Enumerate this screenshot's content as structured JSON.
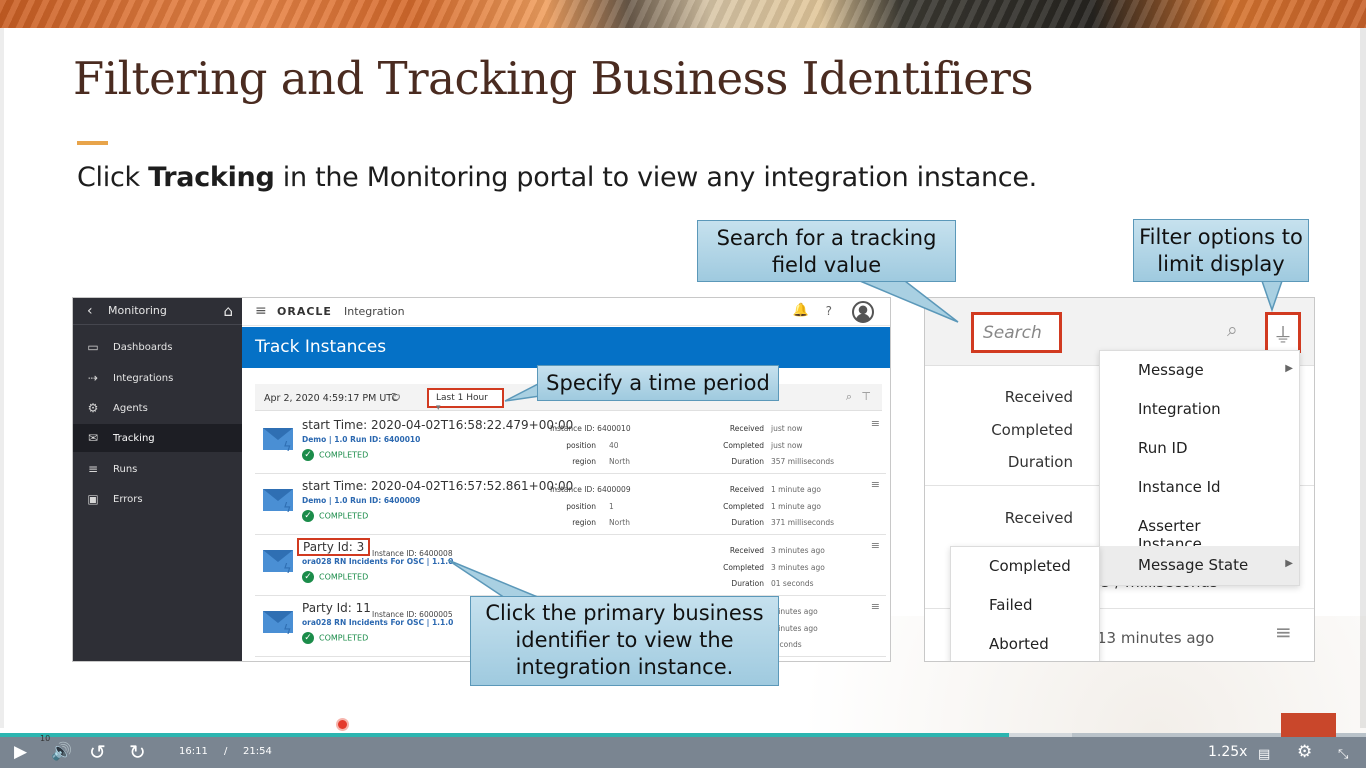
{
  "slide": {
    "title": "Filtering and Tracking Business Identifiers",
    "subtitle_prefix": "Click ",
    "subtitle_bold": "Tracking",
    "subtitle_suffix": " in the Monitoring portal to view any integration instance."
  },
  "sidebar": {
    "header": "Monitoring",
    "items": [
      {
        "label": "Dashboards",
        "icon": "monitor-icon"
      },
      {
        "label": "Integrations",
        "icon": "integrations-icon"
      },
      {
        "label": "Agents",
        "icon": "gear-icon"
      },
      {
        "label": "Tracking",
        "icon": "envelope-icon",
        "active": true
      },
      {
        "label": "Runs",
        "icon": "runs-icon"
      },
      {
        "label": "Errors",
        "icon": "briefcase-icon"
      }
    ]
  },
  "topbar": {
    "brand": "ORACLE",
    "product": "Integration",
    "help": "?"
  },
  "page_title": "Track Instances",
  "filter_bar": {
    "datetime": "Apr 2, 2020 4:59:17 PM UTC",
    "period": "Last 1 Hour"
  },
  "instances": [
    {
      "primary": "start Time: 2020-04-02T16:58:22.479+00:00",
      "link": "Demo | 1.0    Run ID: 6400010",
      "status": "COMPLETED",
      "instance_id": "Instance ID: 6400010",
      "kv": [
        {
          "k": "position",
          "v": "40"
        },
        {
          "k": "region",
          "v": "North"
        }
      ],
      "times": [
        {
          "k": "Received",
          "v": "just now"
        },
        {
          "k": "Completed",
          "v": "just now"
        },
        {
          "k": "Duration",
          "v": "357 milliseconds"
        }
      ]
    },
    {
      "primary": "start Time: 2020-04-02T16:57:52.861+00:00",
      "link": "Demo | 1.0    Run ID: 6400009",
      "status": "COMPLETED",
      "instance_id": "Instance ID: 6400009",
      "kv": [
        {
          "k": "position",
          "v": "1"
        },
        {
          "k": "region",
          "v": "North"
        }
      ],
      "times": [
        {
          "k": "Received",
          "v": "1 minute ago"
        },
        {
          "k": "Completed",
          "v": "1 minute ago"
        },
        {
          "k": "Duration",
          "v": "371 milliseconds"
        }
      ]
    },
    {
      "primary": "Party Id: 3",
      "link": "ora028 RN Incidents For OSC | 1.1.0",
      "status": "COMPLETED",
      "instance_id": "Instance ID: 6400008",
      "kv": [],
      "times": [
        {
          "k": "Received",
          "v": "3 minutes ago"
        },
        {
          "k": "Completed",
          "v": "3 minutes ago"
        },
        {
          "k": "Duration",
          "v": "01 seconds"
        }
      ]
    },
    {
      "primary": "Party Id: 11",
      "link": "ora028 RN Incidents For OSC | 1.1.0",
      "status": "COMPLETED",
      "instance_id": "Instance ID: 6000005",
      "kv": [],
      "times": [
        {
          "k": "",
          "v": "minutes ago"
        },
        {
          "k": "",
          "v": "minutes ago"
        },
        {
          "k": "",
          "v": "seconds"
        }
      ]
    }
  ],
  "callouts": {
    "search": "Search for a tracking field value",
    "filter": "Filter options to limit display",
    "time": "Specify a time period",
    "primary": "Click the primary business identifier to view the integration instance."
  },
  "filter_panel": {
    "search_placeholder": "Search",
    "labels": [
      "Received",
      "Completed",
      "Duration",
      "Received"
    ],
    "menu": [
      "Message",
      "Integration",
      "Run ID",
      "Instance Id",
      "Asserter Instance",
      "Message State"
    ],
    "submenu": [
      "Completed",
      "Failed",
      "Aborted"
    ],
    "tail_text": "13 minutes ago",
    "partial_text": "5 / milliseconds"
  },
  "player": {
    "current": "16:11",
    "separator": "/",
    "total": "21:54",
    "speed": "1.25x",
    "marker": "10",
    "progress_fraction": 0.739
  },
  "colors": {
    "accent": "#e8a44a",
    "oracle_blue": "#0571c6",
    "highlight_red": "#d13a20",
    "progress": "#2cb5b0"
  }
}
